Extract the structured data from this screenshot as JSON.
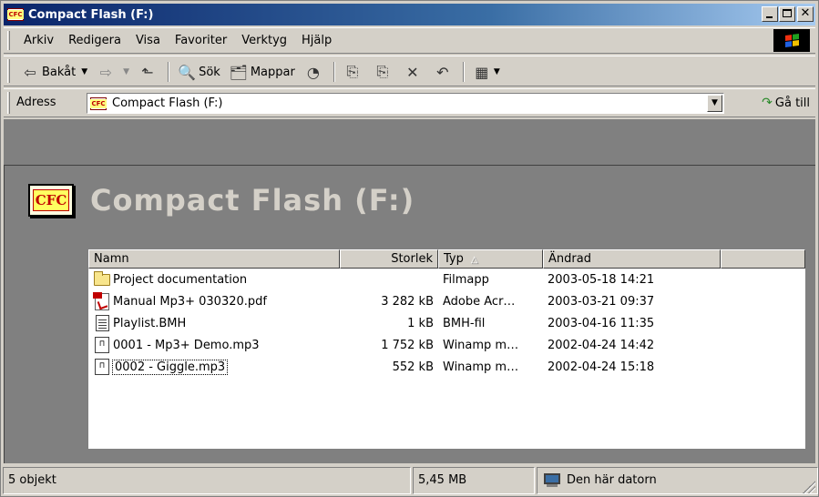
{
  "window": {
    "title": "Compact Flash (F:)",
    "icon_text": "CFC"
  },
  "menu": {
    "items": [
      {
        "label": "Arkiv"
      },
      {
        "label": "Redigera"
      },
      {
        "label": "Visa"
      },
      {
        "label": "Favoriter"
      },
      {
        "label": "Verktyg"
      },
      {
        "label": "Hjälp"
      }
    ]
  },
  "toolbar": {
    "back_label": "Bakåt",
    "search_label": "Sök",
    "folders_label": "Mappar"
  },
  "address": {
    "label": "Adress",
    "value": "Compact Flash (F:)",
    "go_label": "Gå till"
  },
  "folder": {
    "title": "Compact Flash (F:)",
    "icon_text": "CFC"
  },
  "columns": {
    "name": "Namn",
    "size": "Storlek",
    "type": "Typ",
    "date": "Ändrad"
  },
  "files": [
    {
      "name": "Project documentation",
      "size": "",
      "type": "Filmapp",
      "date": "2003-05-18 14:21",
      "icon": "folder-icon"
    },
    {
      "name": "Manual Mp3+ 030320.pdf",
      "size": "3 282 kB",
      "type": "Adobe Acr…",
      "date": "2003-03-21 09:37",
      "icon": "pdf-icon"
    },
    {
      "name": "Playlist.BMH",
      "size": "1 kB",
      "type": "BMH-fil",
      "date": "2003-04-16 11:35",
      "icon": "text-file-icon"
    },
    {
      "name": "0001 - Mp3+ Demo.mp3",
      "size": "1 752 kB",
      "type": "Winamp m…",
      "date": "2002-04-24 14:42",
      "icon": "audio-file-icon"
    },
    {
      "name": "0002 - Giggle.mp3",
      "size": "552 kB",
      "type": "Winamp m…",
      "date": "2002-04-24 15:18",
      "icon": "audio-file-icon"
    }
  ],
  "status": {
    "count": "5 objekt",
    "size": "5,45 MB",
    "zone": "Den här datorn"
  },
  "colors": {
    "title_bar_start": "#0a246a",
    "title_bar_end": "#a6caf0",
    "chrome": "#d4d0c8",
    "content_bg": "#808080"
  }
}
